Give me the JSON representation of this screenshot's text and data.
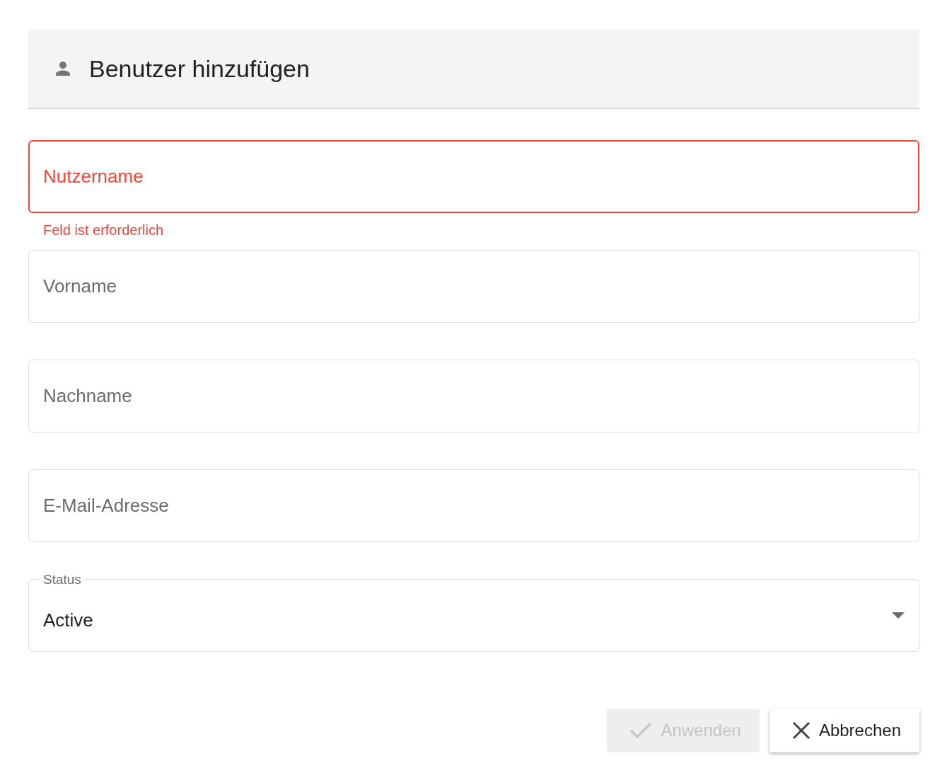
{
  "dialog": {
    "title": "Benutzer hinzufügen"
  },
  "fields": [
    {
      "kind": "text",
      "placeholder": "Nutzername",
      "invalid": true,
      "error": "Feld ist erforderlich"
    },
    {
      "kind": "text",
      "placeholder": "Vorname",
      "invalid": false
    },
    {
      "kind": "text",
      "placeholder": "Nachname",
      "invalid": false
    },
    {
      "kind": "text",
      "placeholder": "E-Mail-Adresse",
      "invalid": false
    },
    {
      "kind": "select",
      "label": "Status",
      "value": "Active",
      "invalid": false
    }
  ],
  "buttons": [
    {
      "kind": "apply",
      "label": "Anwenden",
      "disabled": true
    },
    {
      "kind": "cancel",
      "label": "Abbrechen",
      "disabled": false
    }
  ]
}
